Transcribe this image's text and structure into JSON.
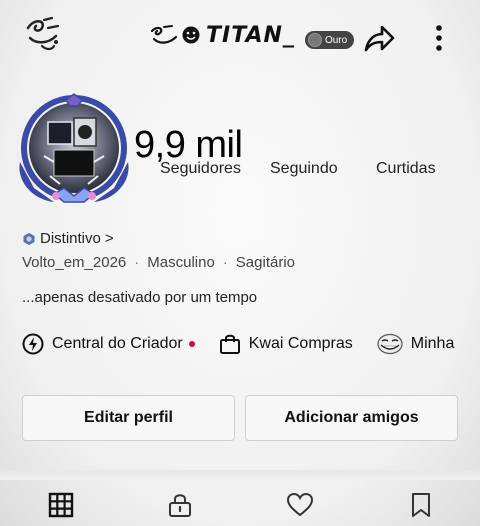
{
  "header": {
    "username": "TITAN_",
    "level_badge": "Ouro",
    "left_icon": "swirl-decor-icon",
    "share_icon": "share-arrow-icon",
    "more_icon": "more-vertical-icon"
  },
  "profile": {
    "followers_count": "9,9 mil",
    "followers_label": "Seguidores",
    "following_label": "Seguindo",
    "likes_label": "Curtidas",
    "badge_link": "Distintivo",
    "badge_chevron": ">",
    "info": {
      "handle": "Volto_em_2026",
      "gender": "Masculino",
      "sign": "Sagitário",
      "separator": "·"
    },
    "bio": "...apenas desativado por um tempo"
  },
  "shortcuts": [
    {
      "label": "Central do Criador",
      "icon": "creator-bolt-icon"
    },
    {
      "label": "Kwai Compras",
      "icon": "shopping-bag-icon"
    },
    {
      "label": "Minha",
      "icon": "troll-face-icon"
    }
  ],
  "buttons": {
    "edit_profile": "Editar perfil",
    "add_friends": "Adicionar amigos"
  },
  "tabs": [
    {
      "icon": "grid-icon"
    },
    {
      "icon": "lock-icon"
    },
    {
      "icon": "heart-icon"
    },
    {
      "icon": "bookmark-icon"
    }
  ],
  "colors": {
    "notification_dot": "#c8102e",
    "avatar_ring": "#3a4aa8"
  }
}
